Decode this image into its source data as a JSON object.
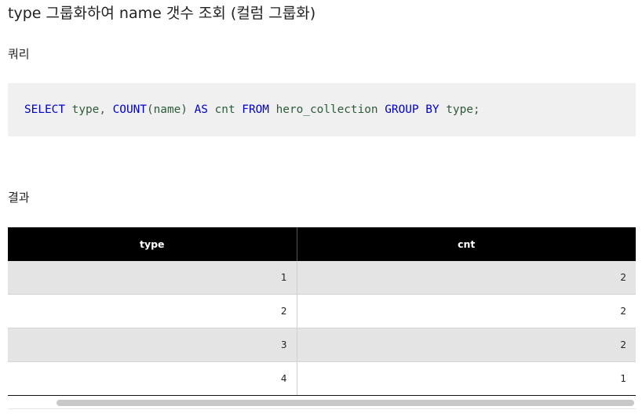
{
  "heading": "type 그룹화하여 name 갯수 조회 (컬럼 그룹화)",
  "query_label": "쿼리",
  "result_label": "결과",
  "code": {
    "tokens": [
      {
        "text": "SELECT",
        "kind": "kw"
      },
      {
        "text": " ",
        "kind": "punct"
      },
      {
        "text": "type",
        "kind": "ident"
      },
      {
        "text": ", ",
        "kind": "punct"
      },
      {
        "text": "COUNT",
        "kind": "kw"
      },
      {
        "text": "(name)",
        "kind": "ident"
      },
      {
        "text": " ",
        "kind": "punct"
      },
      {
        "text": "AS",
        "kind": "kw"
      },
      {
        "text": " ",
        "kind": "punct"
      },
      {
        "text": "cnt",
        "kind": "ident"
      },
      {
        "text": " ",
        "kind": "punct"
      },
      {
        "text": "FROM",
        "kind": "kw"
      },
      {
        "text": " ",
        "kind": "punct"
      },
      {
        "text": "hero_collection",
        "kind": "ident"
      },
      {
        "text": " ",
        "kind": "punct"
      },
      {
        "text": "GROUP BY",
        "kind": "kw"
      },
      {
        "text": " ",
        "kind": "punct"
      },
      {
        "text": "type;",
        "kind": "ident"
      }
    ]
  },
  "table": {
    "headers": [
      "type",
      "cnt"
    ],
    "rows": [
      [
        "1",
        "2"
      ],
      [
        "2",
        "2"
      ],
      [
        "3",
        "2"
      ],
      [
        "4",
        "1"
      ]
    ]
  },
  "colors": {
    "header_bg": "#000000",
    "header_text": "#ffffff",
    "stripe_bg": "#e4e4e4",
    "code_bg": "#f0f0f0",
    "keyword": "#0000cc"
  }
}
